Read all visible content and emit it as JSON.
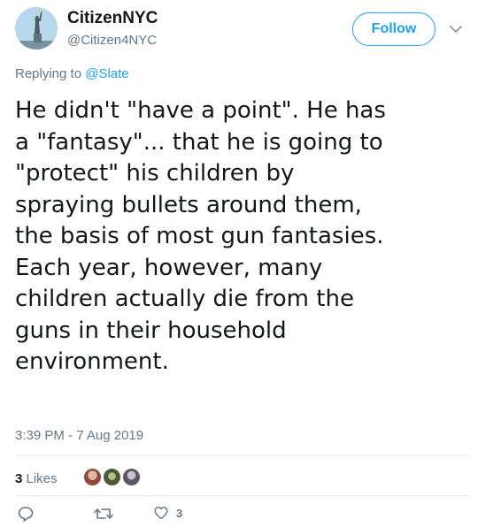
{
  "user": {
    "name": "CitizenNYC",
    "handle": "@Citizen4NYC",
    "avatar_icon": "statue-of-liberty-avatar"
  },
  "follow_button": {
    "label": "Follow"
  },
  "reply": {
    "prefix": "Replying to ",
    "target": "@Slate"
  },
  "tweet": {
    "text": "He didn't \"have a point\". He has\na \"fantasy\"... that he is going to\n\"protect\" his children by\nspraying bullets around them,\nthe basis of most gun fantasies.\nEach year, however, many\nchildren actually die from the\nguns in their household\nenvironment.",
    "timestamp": "3:39 PM - 7 Aug 2019"
  },
  "stats": {
    "likes_count": "3",
    "likes_label": " Likes"
  },
  "actions": {
    "reply_icon": "reply-icon",
    "retweet_icon": "retweet-icon",
    "like_icon": "heart-icon",
    "like_count": "3"
  },
  "colors": {
    "accent": "#1da1f2",
    "muted": "#657786",
    "text": "#14171a",
    "divider": "#e6ecf0"
  }
}
